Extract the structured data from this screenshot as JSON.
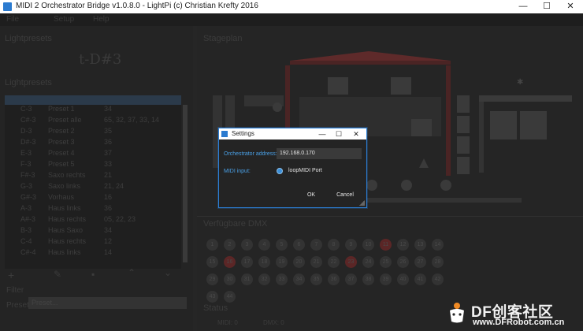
{
  "window": {
    "title": "MIDI 2 Orchestrator Bridge v1.0.8.0 - LightPi (c) Christian Krefty 2016",
    "minimize_glyph": "—",
    "maximize_glyph": "☐",
    "close_glyph": "✕"
  },
  "menu": {
    "items": [
      "File",
      "Setup",
      "Help"
    ]
  },
  "left_panel": {
    "section_title": "Lightpresets",
    "current_note": "t-D#3",
    "list_title": "Lightpresets",
    "rows": [
      {
        "note": "C-3",
        "name": "Preset 1",
        "val": "34"
      },
      {
        "note": "C#-3",
        "name": "Preset alle",
        "val": "65, 32, 37, 33, 14"
      },
      {
        "note": "D-3",
        "name": "Preset 2",
        "val": "35"
      },
      {
        "note": "D#-3",
        "name": "Preset 3",
        "val": "36"
      },
      {
        "note": "E-3",
        "name": "Preset 4",
        "val": "37"
      },
      {
        "note": "F-3",
        "name": "Preset 5",
        "val": "33"
      },
      {
        "note": "F#-3",
        "name": "Saxo rechts",
        "val": "21"
      },
      {
        "note": "G-3",
        "name": "Saxo links",
        "val": "21, 24"
      },
      {
        "note": "G#-3",
        "name": "Vorhaus",
        "val": "16"
      },
      {
        "note": "A-3",
        "name": "Haus links",
        "val": "36"
      },
      {
        "note": "A#-3",
        "name": "Haus rechts",
        "val": "05, 22, 23"
      },
      {
        "note": "B-3",
        "name": "Haus Saxo",
        "val": "34"
      },
      {
        "note": "C-4",
        "name": "Haus rechts",
        "val": "12"
      },
      {
        "note": "C#-4",
        "name": "Haus links",
        "val": "14"
      }
    ],
    "filter_label": "Filter",
    "preset_label": "Preset",
    "preset_value": "Preset..."
  },
  "right_panel": {
    "stage_title": "Stageplan",
    "dmx_title": "Verfügbare DMX",
    "grid_numbers": [
      "1",
      "2",
      "3",
      "4",
      "5",
      "6",
      "7",
      "8",
      "9",
      "10",
      "11",
      "12",
      "13",
      "14",
      "15",
      "16",
      "17",
      "18",
      "19",
      "20",
      "21",
      "22",
      "23",
      "24",
      "25",
      "26",
      "27",
      "28",
      "29",
      "30",
      "31",
      "32",
      "33",
      "34",
      "35",
      "36",
      "37",
      "38",
      "39",
      "40",
      "41",
      "42",
      "43",
      "44"
    ],
    "status_title": "Status",
    "status_items": [
      "MIDI: 0",
      "DMX: 0"
    ]
  },
  "dialog": {
    "title": "Settings",
    "address_label": "Orchestrator address:",
    "address_value": "192.168.0.170",
    "midi_label": "MIDI input:",
    "midi_port": "loopMIDI Port",
    "ok_label": "OK",
    "cancel_label": "Cancel",
    "minimize_glyph": "—",
    "maximize_glyph": "☐",
    "close_glyph": "✕"
  },
  "watermark": {
    "brand": "DF创客社区",
    "url": "www.DFRobot.com.cn"
  },
  "colors": {
    "accent": "#2c7fd6",
    "label_blue": "#4aa0e6",
    "background": "#262626",
    "stage_roof": "#6b2e2e"
  }
}
